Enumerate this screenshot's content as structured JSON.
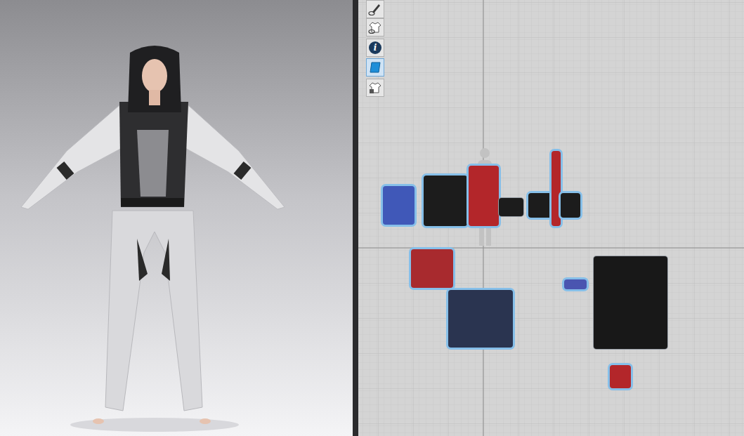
{
  "viewport": {
    "kind": "3d-avatar"
  },
  "toolbar": [
    {
      "kind": "pen",
      "selected": false
    },
    {
      "kind": "garment",
      "selected": false
    },
    {
      "kind": "info",
      "glyph": "i",
      "selected": false
    },
    {
      "kind": "layer",
      "selected": true
    },
    {
      "kind": "lock",
      "selected": false
    }
  ],
  "pieces": [
    {
      "color": "#4058b8",
      "selected": true
    },
    {
      "color": "#1c1c1c",
      "selected": true
    },
    {
      "color": "#b3262a",
      "selected": true
    },
    {
      "color": "#1c1c1c",
      "selected": false
    },
    {
      "color": "#1c1c1c",
      "selected": true
    },
    {
      "color": "#b3262a",
      "selected": true
    },
    {
      "color": "#1c1c1c",
      "selected": true
    },
    {
      "color": "#a82a2e",
      "selected": true
    },
    {
      "color": "#2a3450",
      "selected": true
    },
    {
      "color": "#4a55b0",
      "selected": true
    },
    {
      "color": "#181818",
      "selected": false
    },
    {
      "color": "#b3262a",
      "selected": true
    }
  ]
}
